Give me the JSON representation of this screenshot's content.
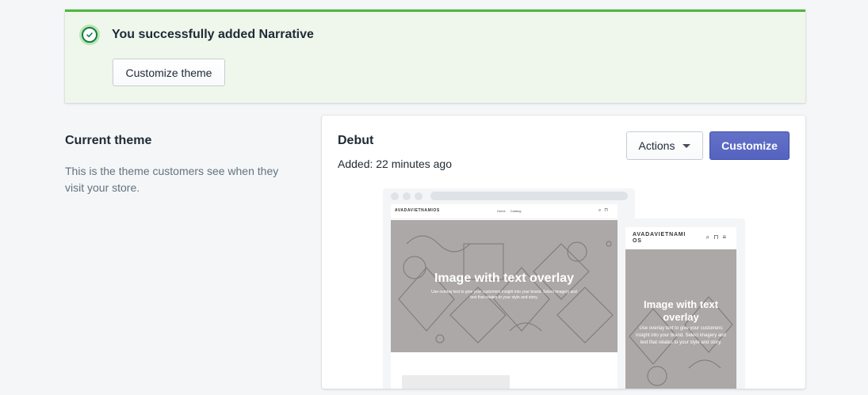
{
  "banner": {
    "title": "You successfully added Narrative",
    "button_label": "Customize theme",
    "icon": "check-circle-icon",
    "accent_color": "#50b83c"
  },
  "current_theme": {
    "title": "Current theme",
    "description": "This is the theme customers see when they visit your store."
  },
  "theme_card": {
    "name": "Debut",
    "added": "Added: 22 minutes ago",
    "actions_label": "Actions",
    "customize_label": "Customize",
    "primary_color": "#5c6ac4"
  },
  "preview": {
    "store_name": "AVADAVIETNAMIOS",
    "mobile_store_name": "AVADAVIETNAMI OS",
    "nav_links": [
      "Home",
      "Catalog"
    ],
    "hero_title": "Image with text overlay",
    "hero_text": "Use overlay text to give your customers insight into your brand. Select imagery and text that relates to your style and story.",
    "mobile_hero_text": "Use overlay text to give your customers insight into your brand. Select imagery and text that relates to your style and story."
  }
}
